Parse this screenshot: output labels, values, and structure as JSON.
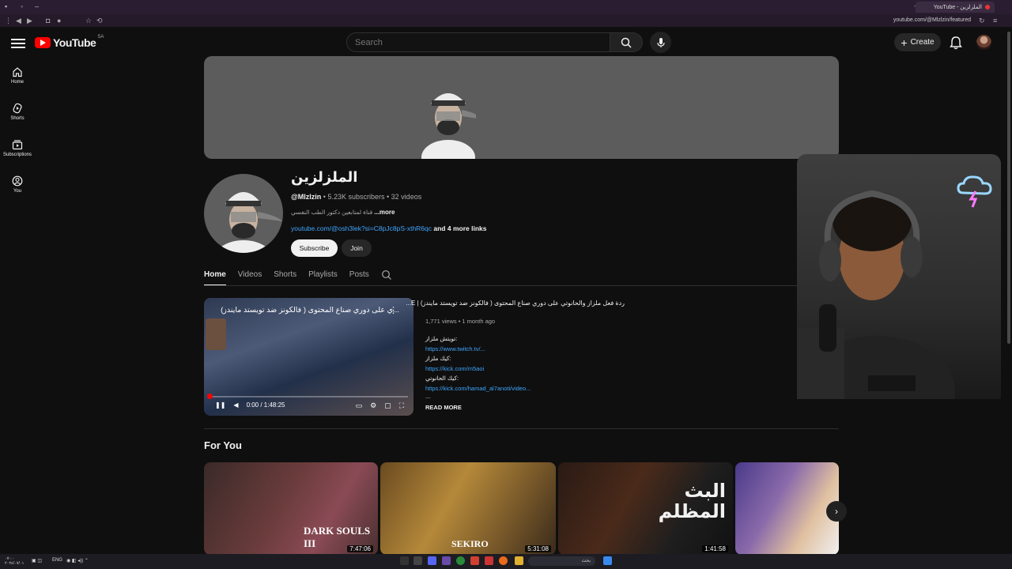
{
  "browser": {
    "tab_title": "YouTube - الملزلزين",
    "url": "youtube.com/@Mlzlzin/featured"
  },
  "header": {
    "logo_text": "YouTube",
    "country_code": "SA",
    "search_placeholder": "Search",
    "create_label": "Create"
  },
  "guide": [
    {
      "label": "Home",
      "icon": "home-icon"
    },
    {
      "label": "Shorts",
      "icon": "shorts-icon"
    },
    {
      "label": "Subscriptions",
      "icon": "subscriptions-icon"
    },
    {
      "label": "You",
      "icon": "you-icon"
    }
  ],
  "channel": {
    "name": "الملزلزين",
    "handle": "@Mlzlzin",
    "subscribers": "5.23K subscribers",
    "videos": "32 videos",
    "description": "قناة لمتابعين دكتور الطب النفسي",
    "more_label": "...more",
    "link": "youtube.com/@osh3lek?si=C8pJc8pS-xthR6qc",
    "more_links": "and 4 more links",
    "subscribe_label": "Subscribe",
    "join_label": "Join"
  },
  "tabs": [
    {
      "label": "Home",
      "active": true
    },
    {
      "label": "Videos",
      "active": false
    },
    {
      "label": "Shorts",
      "active": false
    },
    {
      "label": "Playlists",
      "active": false
    },
    {
      "label": "Posts",
      "active": false
    }
  ],
  "featured": {
    "player_title": "...ي على دوري صناع المحتوى ( فالكونز ضد تويستد مايندز)",
    "time": "0:00 / 1:48:25",
    "title": "ردة فعل ملزاز والحانوتي على دوري صناع المحتوى ( فالكونز ضد تويستد مايندز) | E...",
    "views": "1,771 views",
    "age": "1 month ago",
    "desc_lines": [
      {
        "label": "تويتش ملزاز:",
        "link": " https://www.twitch.tv/..."
      },
      {
        "label": "كيك ملزاز:",
        "link": "https://kick.com/m5aoi"
      },
      {
        "label": "كيك الحانوتي:",
        "link": "https://kick.com/hamad_al7anoti/video..."
      }
    ],
    "ellipsis": "...",
    "read_more": "READ MORE"
  },
  "for_you": {
    "heading": "For You",
    "cards": [
      {
        "overlay": "DARK SOULS III",
        "duration": "7:47:06"
      },
      {
        "overlay": "SEKIRO",
        "duration": "5:31:08"
      },
      {
        "overlay": "البث المظلم",
        "duration": "1:41:58"
      },
      {
        "overlay": "",
        "duration": ""
      }
    ]
  },
  "taskbar": {
    "search_text": "بحث",
    "lang": "ENG",
    "time": "٠٧:٠٠",
    "date": "٢٠٢٤/٠٧/٠١"
  },
  "colors": {
    "background": "#0f0f0f",
    "brand_red": "#ff0000",
    "link_blue": "#3ea6ff",
    "text_secondary": "#aaaaaa"
  }
}
